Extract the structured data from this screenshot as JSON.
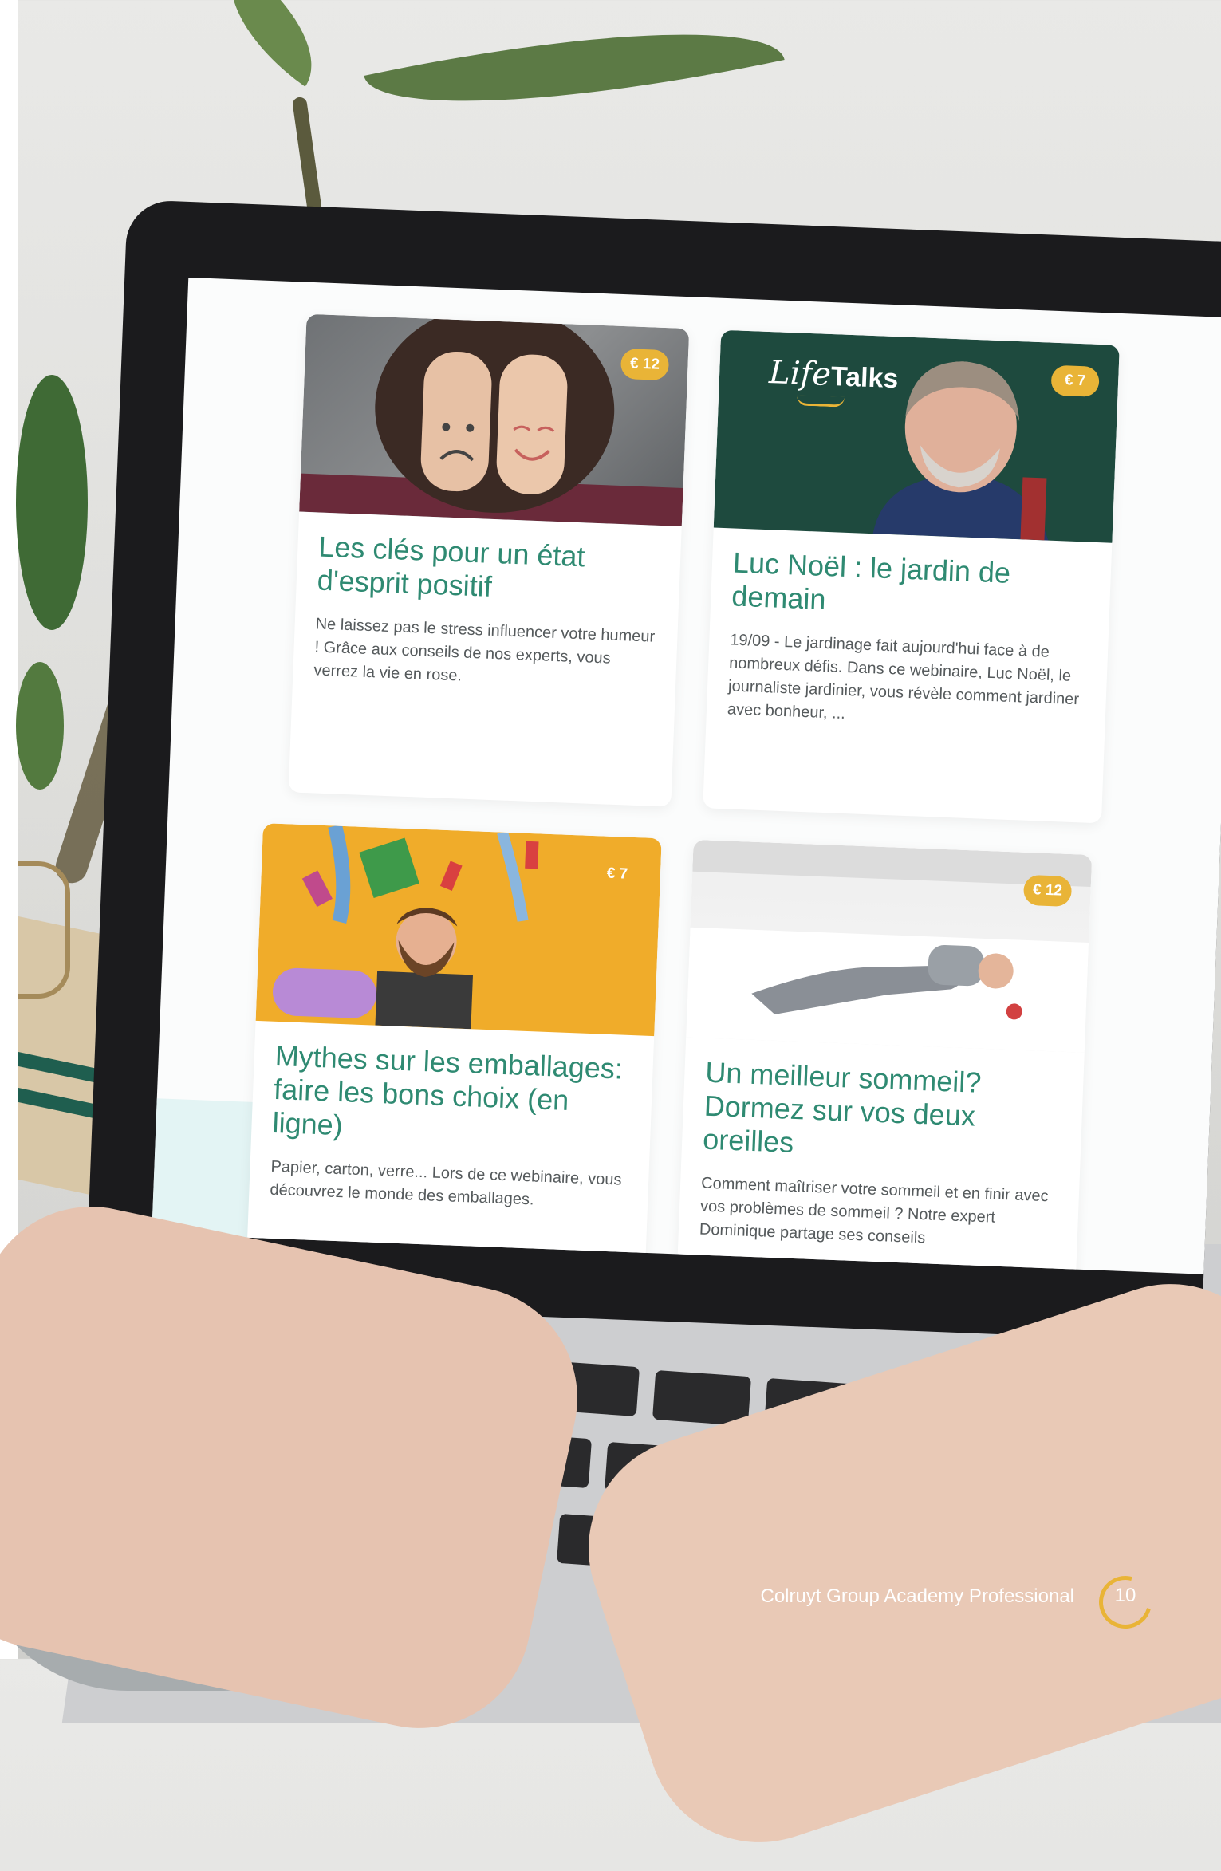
{
  "cards": [
    {
      "price": "€ 12",
      "title": "Les clés pour un état d'esprit positif",
      "description": "Ne laissez pas le stress influencer votre humeur ! Grâce aux conseils de nos experts, vous verrez la vie en rose."
    },
    {
      "price": "€ 7",
      "logo_life": "Life",
      "logo_talks": "Talks",
      "title": "Luc Noël : le jardin de demain",
      "description": "19/09 - Le jardinage fait aujourd'hui face à de nombreux défis. Dans ce webinaire, Luc Noël, le journaliste jardinier, vous révèle comment jardiner avec bonheur, ..."
    },
    {
      "price": "€ 7",
      "title": "Mythes sur les emballages: faire les bons choix (en ligne)",
      "description": "Papier, carton, verre... Lors de ce webinaire, vous découvrez le monde des emballages."
    },
    {
      "price": "€ 12",
      "title": "Un meilleur sommeil? Dormez sur vos deux oreilles",
      "description": "Comment maîtriser votre sommeil et en finir avec vos problèmes de sommeil ? Notre expert Dominique partage ses conseils"
    }
  ],
  "footer": {
    "brand": "Colruyt Group Academy Professional",
    "page_number": "10"
  },
  "colors": {
    "accent_green": "#2f8a72",
    "price_badge": "#e9b437",
    "text_gray": "#555a5c"
  }
}
